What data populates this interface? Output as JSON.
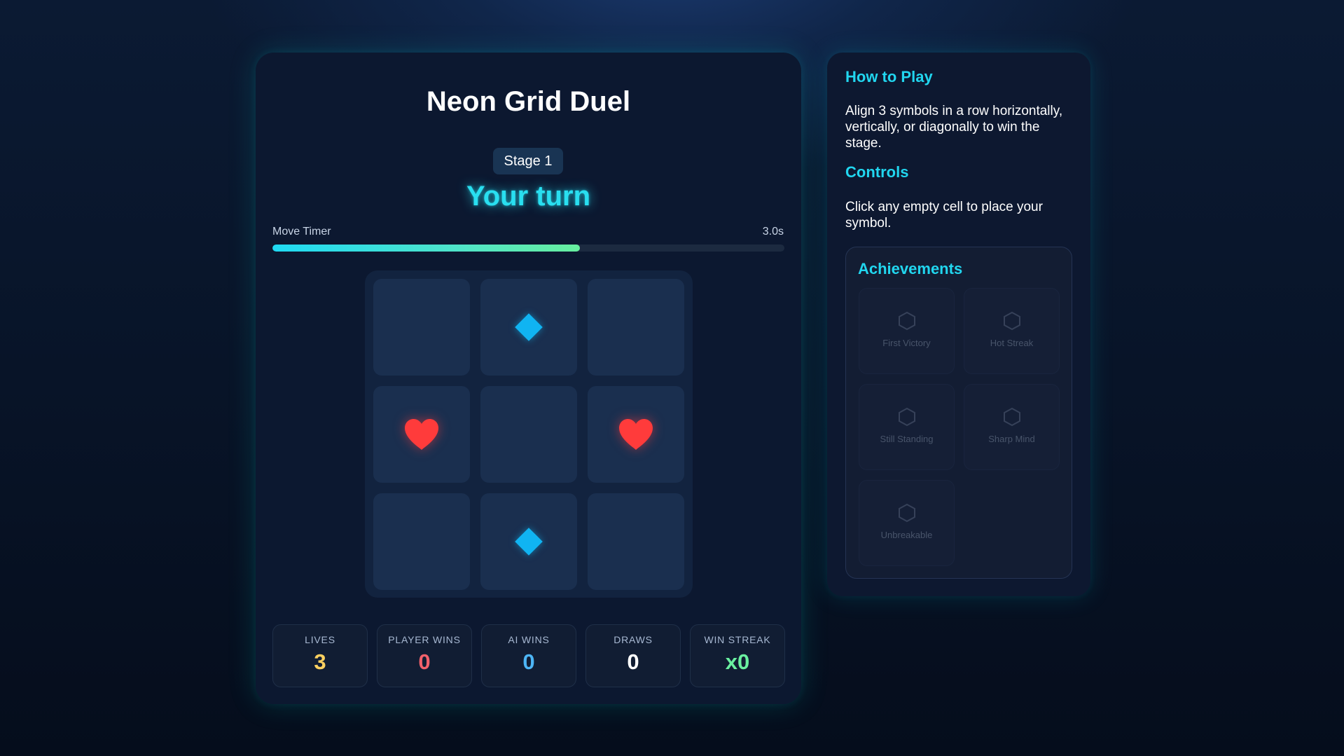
{
  "game": {
    "title": "Neon Grid Duel",
    "stage": "Stage 1",
    "turn_status": "Your turn",
    "timer": {
      "label": "Move Timer",
      "value": "3.0s",
      "progress_fraction": 0.6
    },
    "board": {
      "cells": [
        "",
        "diamond",
        "",
        "heart",
        "",
        "heart",
        "",
        "diamond",
        ""
      ]
    },
    "stats": [
      {
        "label": "LIVES",
        "value": "3",
        "color": "#fcd060"
      },
      {
        "label": "PLAYER WINS",
        "value": "0",
        "color": "#f2616b"
      },
      {
        "label": "AI WINS",
        "value": "0",
        "color": "#4db5f5"
      },
      {
        "label": "DRAWS",
        "value": "0",
        "color": "#ffffff"
      },
      {
        "label": "WIN STREAK",
        "value": "x0",
        "color": "#6af0a0"
      }
    ]
  },
  "sidebar": {
    "how_to_play": {
      "heading": "How to Play",
      "text": "Align 3 symbols in a row horizontally, vertically, or diagonally to win the stage."
    },
    "controls": {
      "heading": "Controls",
      "text": "Click any empty cell to place your symbol."
    },
    "achievements": {
      "heading": "Achievements",
      "items": [
        {
          "name": "First Victory",
          "icon": "hexagon-icon",
          "unlocked": false
        },
        {
          "name": "Hot Streak",
          "icon": "hexagon-icon",
          "unlocked": false
        },
        {
          "name": "Still Standing",
          "icon": "hexagon-icon",
          "unlocked": false
        },
        {
          "name": "Sharp Mind",
          "icon": "hexagon-icon",
          "unlocked": false
        },
        {
          "name": "Unbreakable",
          "icon": "hexagon-icon",
          "unlocked": false
        }
      ]
    }
  },
  "colors": {
    "accent": "#21d6ef",
    "player_symbol": "#ff3b3b",
    "ai_symbol": "#10b4f2"
  }
}
